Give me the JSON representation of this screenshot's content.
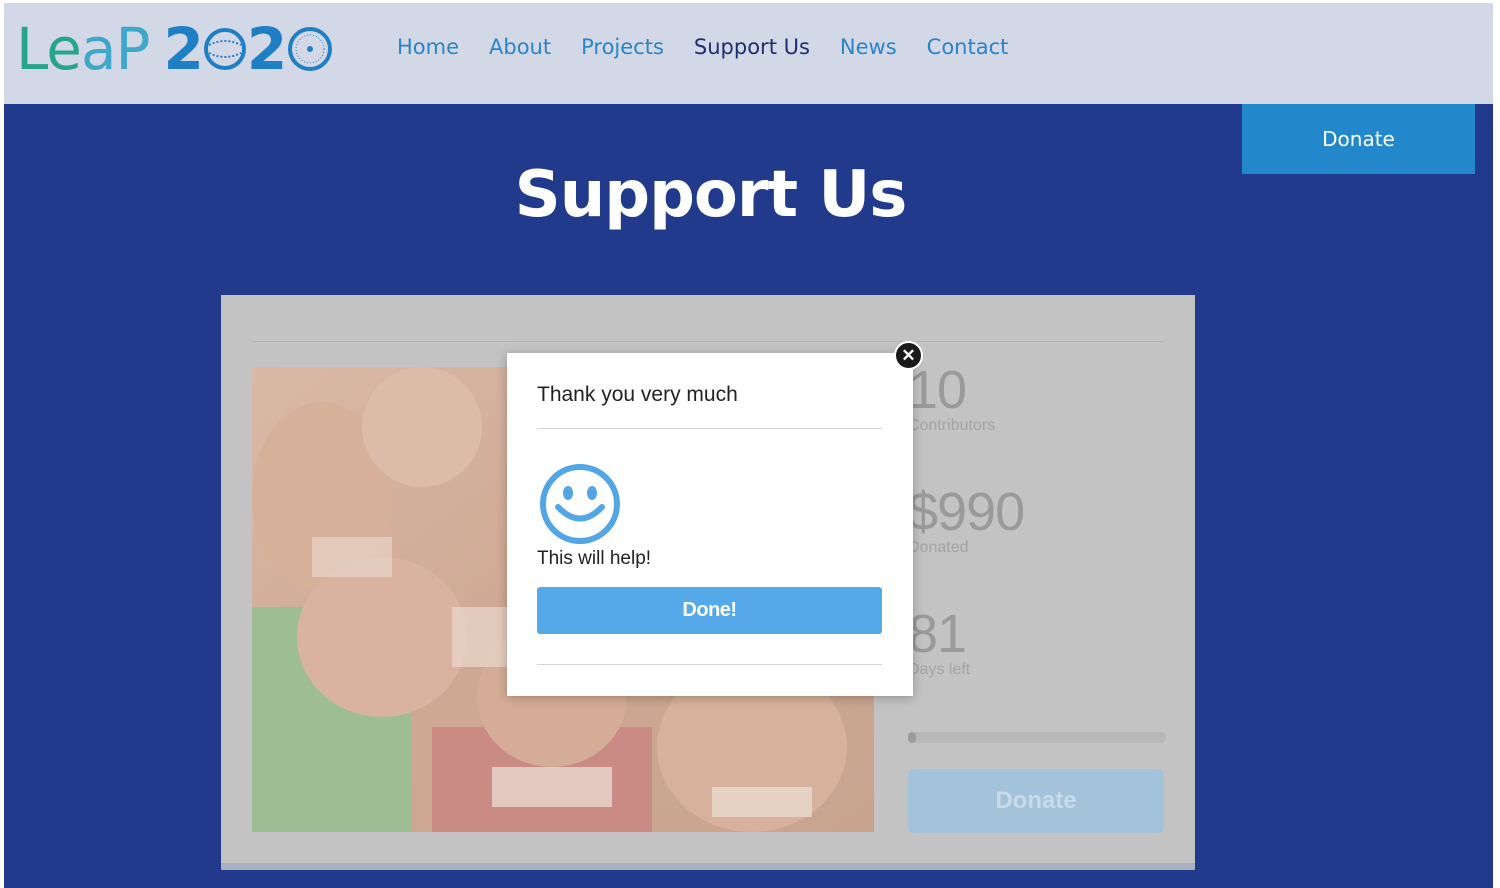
{
  "logo": {
    "part1": "Le",
    "part2": "aP",
    "part3": "2"
  },
  "nav": {
    "items": [
      "Home",
      "About",
      "Projects",
      "Support Us",
      "News",
      "Contact"
    ],
    "active": "Support Us"
  },
  "header": {
    "donate_label": "Donate"
  },
  "page": {
    "title": "Support Us"
  },
  "campaign": {
    "contributors_value": "10",
    "contributors_label": "Contributors",
    "donated_value": "$990",
    "donated_label": "Donated",
    "days_value": "81",
    "days_label": "Days left",
    "progress_fraction": 0.03,
    "donate_label": "Donate"
  },
  "modal": {
    "title": "Thank you very much",
    "message": "This will help!",
    "done_label": "Done!",
    "close_label": "✕"
  },
  "colors": {
    "page_bg": "#213a8c",
    "header_bg": "#d3d8e7",
    "nav_link": "#2b84c6",
    "nav_active": "#1c2f6e",
    "donate_button": "#2388cb",
    "modal_button": "#55a9e8"
  }
}
